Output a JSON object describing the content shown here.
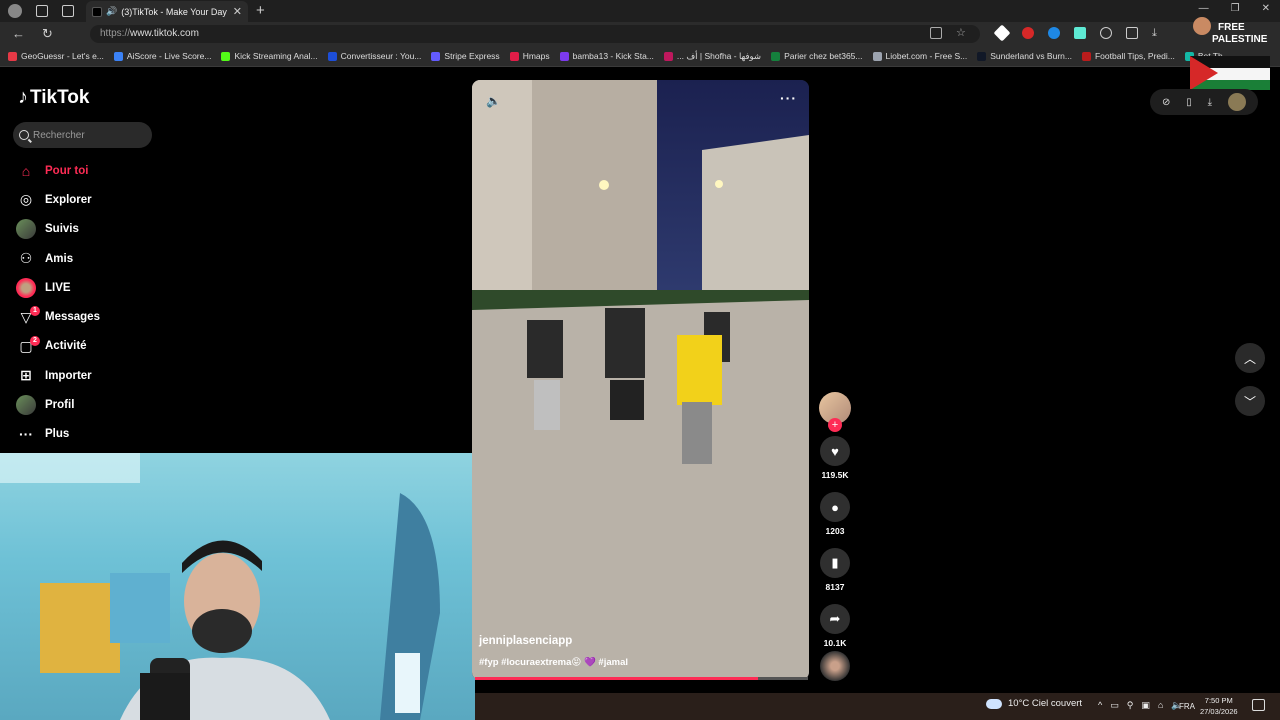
{
  "browser": {
    "tab_title": "(3)TikTok - Make Your Day",
    "url_prefix": "https://",
    "url_host": "www.tiktok.com",
    "bookmarks": [
      {
        "label": "GeoGuessr - Let's e...",
        "color": "#e63946"
      },
      {
        "label": "AiScore - Live Score...",
        "color": "#3b82f6"
      },
      {
        "label": "Kick Streaming Anal...",
        "color": "#53fc18"
      },
      {
        "label": "Convertisseur : You...",
        "color": "#1d4ed8"
      },
      {
        "label": "Stripe Express",
        "color": "#635bff"
      },
      {
        "label": "Hmaps",
        "color": "#e11d48"
      },
      {
        "label": "bamba13 - Kick Sta...",
        "color": "#7c3aed"
      },
      {
        "label": "... أف | Shofha - شوفها",
        "color": "#be185d"
      },
      {
        "label": "Parier chez bet365...",
        "color": "#15803d"
      },
      {
        "label": "Liobet.com - Free S...",
        "color": "#9ca3af"
      },
      {
        "label": "Sunderland vs Burn...",
        "color": "#111827"
      },
      {
        "label": "Football Tips, Predi...",
        "color": "#b91c1c"
      },
      {
        "label": "Bet Th",
        "color": "#14b8a6"
      }
    ]
  },
  "sticker": {
    "line1": "FREE",
    "line2": "PALESTINE"
  },
  "tiktok": {
    "logo": "TikTok",
    "search_placeholder": "Rechercher",
    "nav": [
      {
        "label": "Pour toi",
        "icon": "home-icon"
      },
      {
        "label": "Explorer",
        "icon": "compass-icon"
      },
      {
        "label": "Suivis",
        "icon": "following-avatar-icon"
      },
      {
        "label": "Amis",
        "icon": "friends-icon"
      },
      {
        "label": "LIVE",
        "icon": "live-icon"
      },
      {
        "label": "Messages",
        "icon": "messages-icon",
        "badge": "1"
      },
      {
        "label": "Activité",
        "icon": "activity-icon",
        "badge": "2"
      },
      {
        "label": "Importer",
        "icon": "upload-icon"
      },
      {
        "label": "Profil",
        "icon": "profile-avatar-icon"
      },
      {
        "label": "Plus",
        "icon": "more-icon"
      }
    ]
  },
  "video": {
    "author": "jenniplasenciapp",
    "caption": "#fyp #locuraextrema😝 💜 #jamal",
    "progress": 0.85,
    "likes": "119.5K",
    "comments": "1203",
    "saves": "8137",
    "shares": "10.1K"
  },
  "taskbar": {
    "weather": "10°C  Ciel couvert",
    "lang": "FRA",
    "time": "7:50 PM",
    "date": "27/03/2026"
  },
  "colors": {
    "accent": "#fe2c55"
  }
}
